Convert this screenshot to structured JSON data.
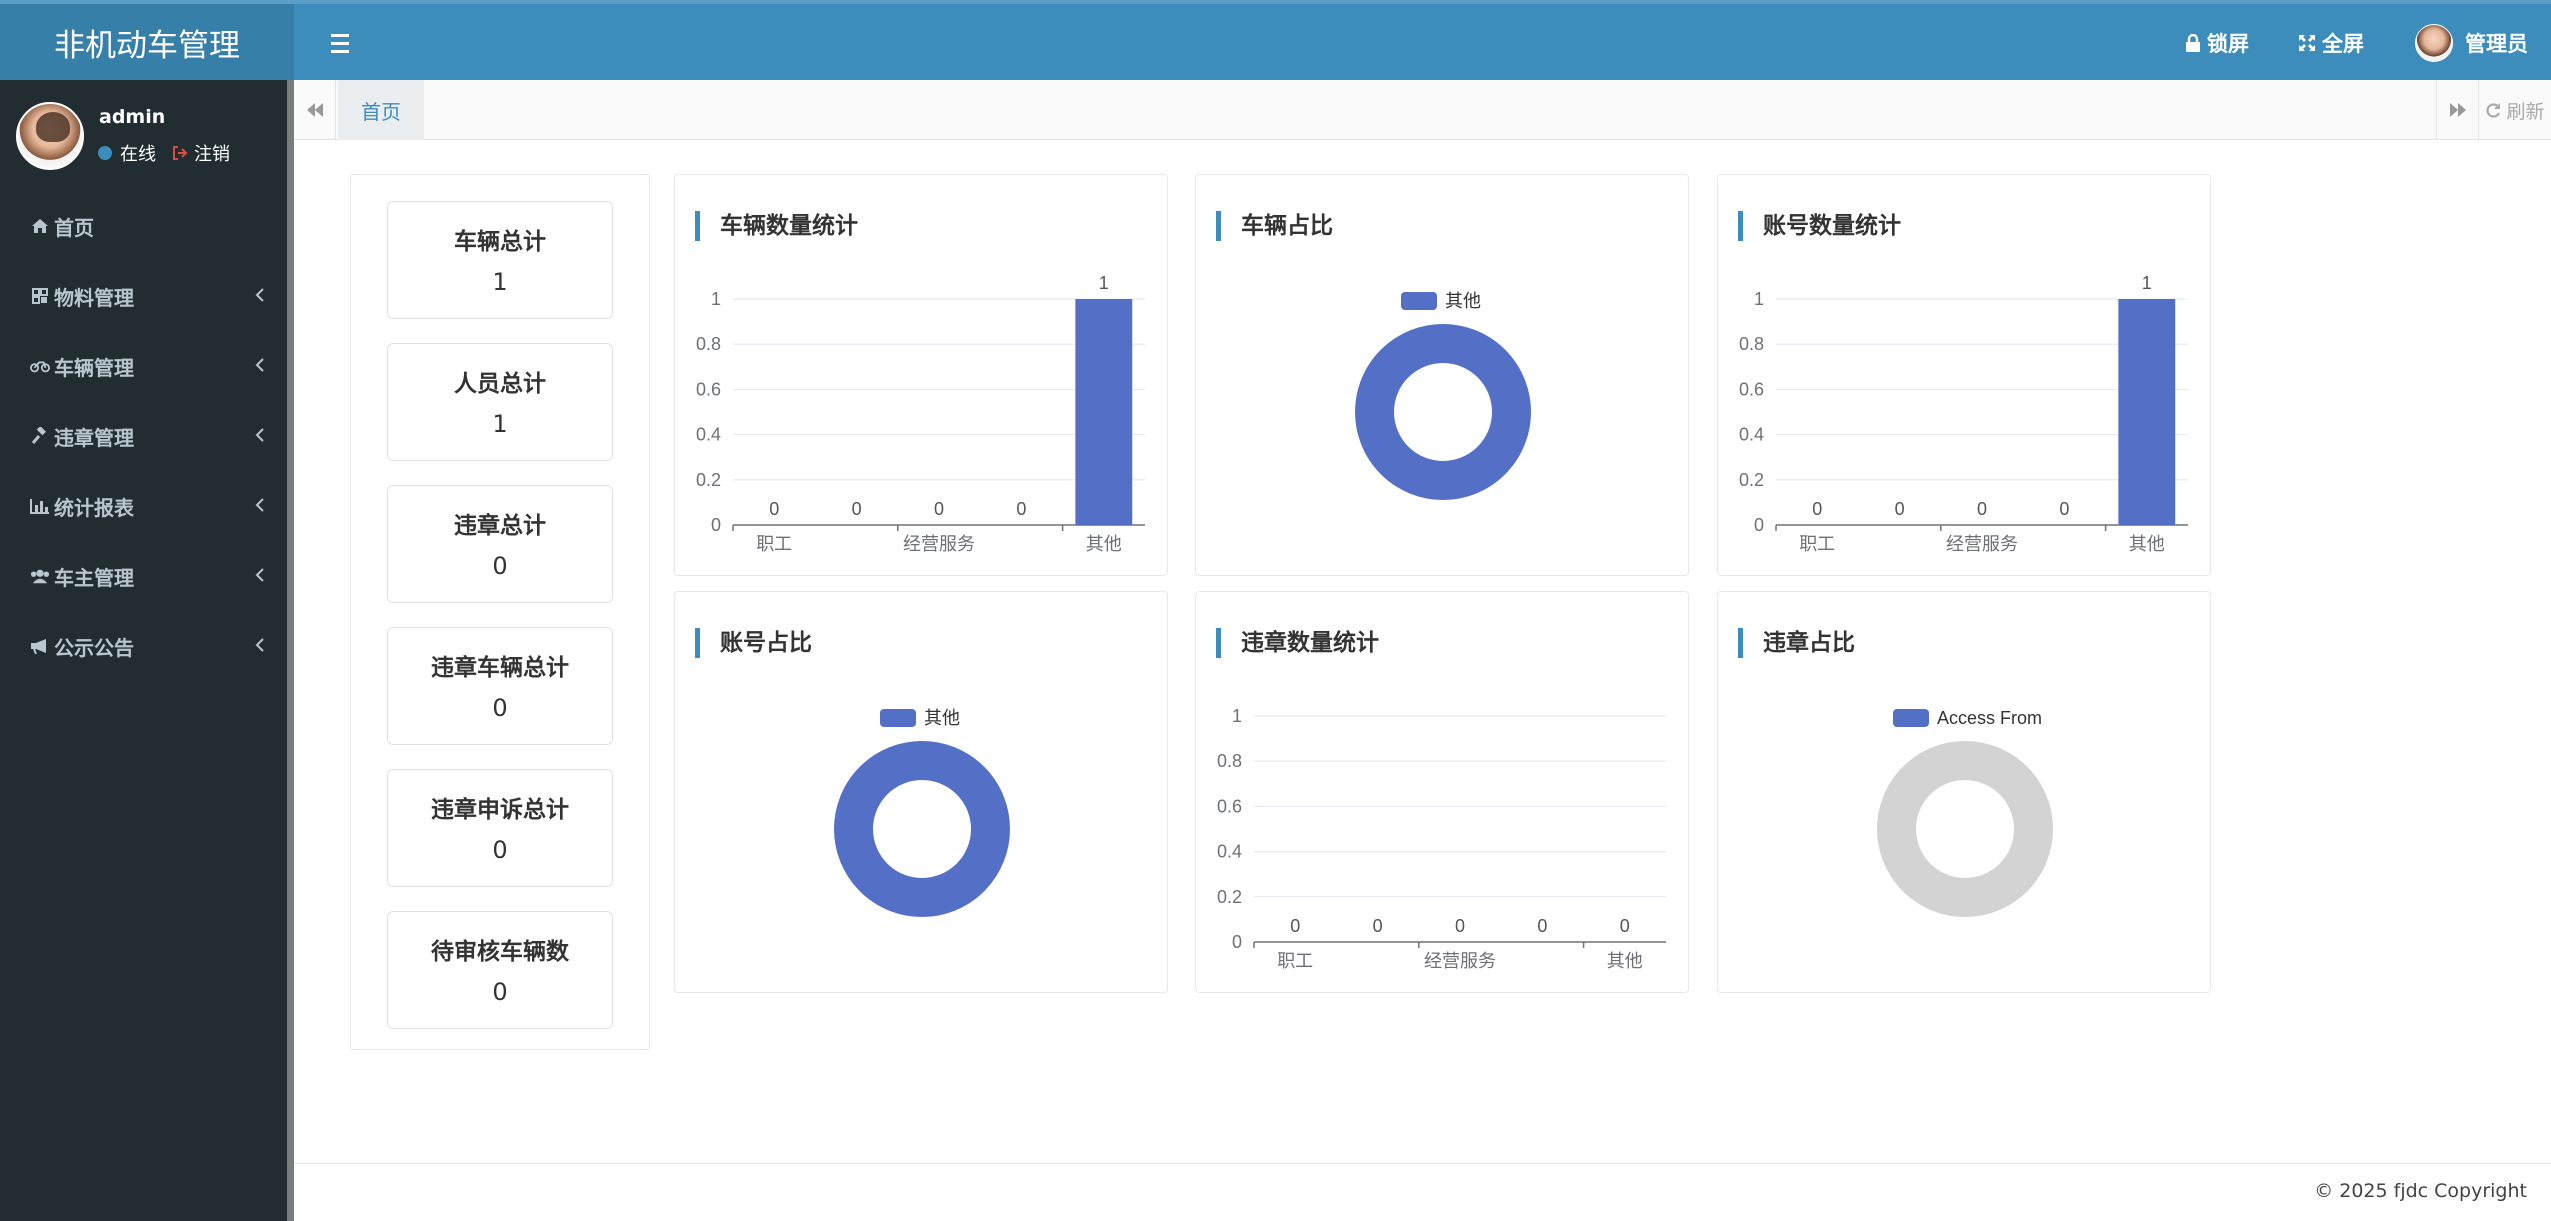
{
  "app": {
    "title": "非机动车管理"
  },
  "header": {
    "lock_label": "锁屏",
    "fullscreen_label": "全屏",
    "user_label": "管理员"
  },
  "sidebar": {
    "user_name": "admin",
    "status_online": "在线",
    "logout_label": "注销",
    "items": [
      {
        "label": "首页",
        "icon": "home-icon"
      },
      {
        "label": "物料管理",
        "icon": "grid-icon"
      },
      {
        "label": "车辆管理",
        "icon": "motorcycle-icon"
      },
      {
        "label": "违章管理",
        "icon": "gavel-icon"
      },
      {
        "label": "统计报表",
        "icon": "bar-chart-icon"
      },
      {
        "label": "车主管理",
        "icon": "users-icon"
      },
      {
        "label": "公示公告",
        "icon": "bullhorn-icon"
      }
    ]
  },
  "tabs": {
    "home_label": "首页",
    "refresh_label": "刷新"
  },
  "stats": [
    {
      "label": "车辆总计",
      "value": "1"
    },
    {
      "label": "人员总计",
      "value": "1"
    },
    {
      "label": "违章总计",
      "value": "0"
    },
    {
      "label": "违章车辆总计",
      "value": "0"
    },
    {
      "label": "违章申诉总计",
      "value": "0"
    },
    {
      "label": "待审核车辆数",
      "value": "0"
    }
  ],
  "chart_data": [
    {
      "type": "bar",
      "title": "车辆数量统计",
      "categories": [
        "职工",
        "",
        "经营服务",
        "",
        "其他"
      ],
      "values": [
        0,
        0,
        0,
        0,
        1
      ],
      "ylim": [
        0,
        1
      ],
      "yticks": [
        "0",
        "0.2",
        "0.4",
        "0.6",
        "0.8",
        "1"
      ],
      "color": "#5470c6",
      "grid": true
    },
    {
      "type": "pie",
      "title": "车辆占比",
      "legend": [
        "其他"
      ],
      "values": [
        1
      ],
      "colors": [
        "#5470c6"
      ],
      "legend_position": "top"
    },
    {
      "type": "bar",
      "title": "账号数量统计",
      "categories": [
        "职工",
        "",
        "经营服务",
        "",
        "其他"
      ],
      "values": [
        0,
        0,
        0,
        0,
        1
      ],
      "ylim": [
        0,
        1
      ],
      "yticks": [
        "0",
        "0.2",
        "0.4",
        "0.6",
        "0.8",
        "1"
      ],
      "color": "#5470c6",
      "grid": true
    },
    {
      "type": "pie",
      "title": "账号占比",
      "legend": [
        "其他"
      ],
      "values": [
        1
      ],
      "colors": [
        "#5470c6"
      ],
      "legend_position": "top"
    },
    {
      "type": "bar",
      "title": "违章数量统计",
      "categories": [
        "职工",
        "",
        "经营服务",
        "",
        "其他"
      ],
      "values": [
        0,
        0,
        0,
        0,
        0
      ],
      "ylim": [
        0,
        1
      ],
      "yticks": [
        "0",
        "0.2",
        "0.4",
        "0.6",
        "0.8",
        "1"
      ],
      "color": "#5470c6",
      "grid": true
    },
    {
      "type": "pie",
      "title": "违章占比",
      "legend": [
        "Access From"
      ],
      "values": [
        0
      ],
      "colors": [
        "#d3d3d3"
      ],
      "legend_position": "top"
    }
  ],
  "footer": {
    "copyright": "© 2025 fjdc Copyright"
  }
}
